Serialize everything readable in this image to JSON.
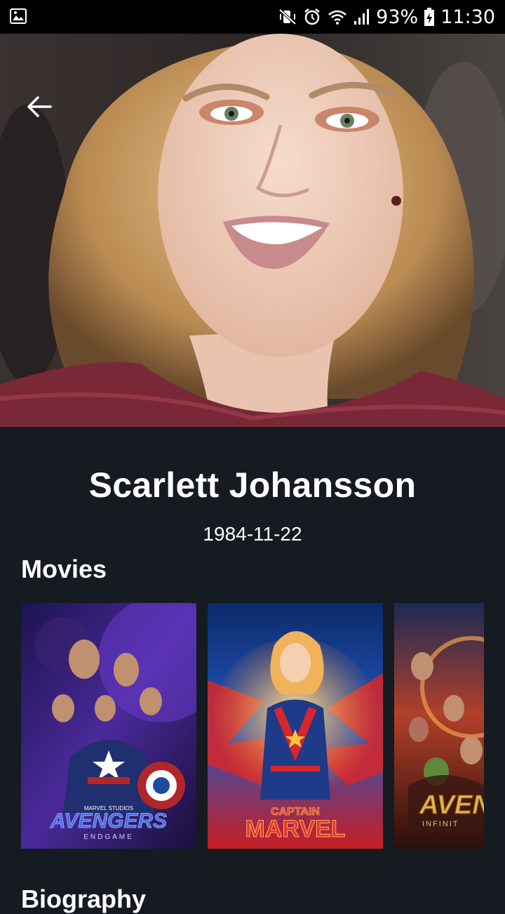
{
  "status_bar": {
    "battery": "93%",
    "time": "11:30",
    "left_icon": "image-notification-icon",
    "icons": [
      "mute-icon",
      "alarm-icon",
      "wifi-icon",
      "signal-icon",
      "battery-charging-icon"
    ]
  },
  "header": {
    "back_icon": "arrow-left-icon"
  },
  "person": {
    "name": "Scarlett Johansson",
    "birth_date": "1984-11-22"
  },
  "movies": {
    "title": "Movies",
    "posters": [
      {
        "title_art": "AVENGERS",
        "subtitle_art": "ENDGAME",
        "studio": "MARVEL STUDIOS"
      },
      {
        "title_art": "CAPTAIN",
        "subtitle_art": "MARVEL"
      },
      {
        "title_art": "AVEN",
        "subtitle_art": "INFINIT"
      }
    ]
  },
  "biography": {
    "title": "Biography"
  },
  "colors": {
    "background": "#161a21",
    "status_bar": "#000000",
    "text": "#ffffff"
  }
}
